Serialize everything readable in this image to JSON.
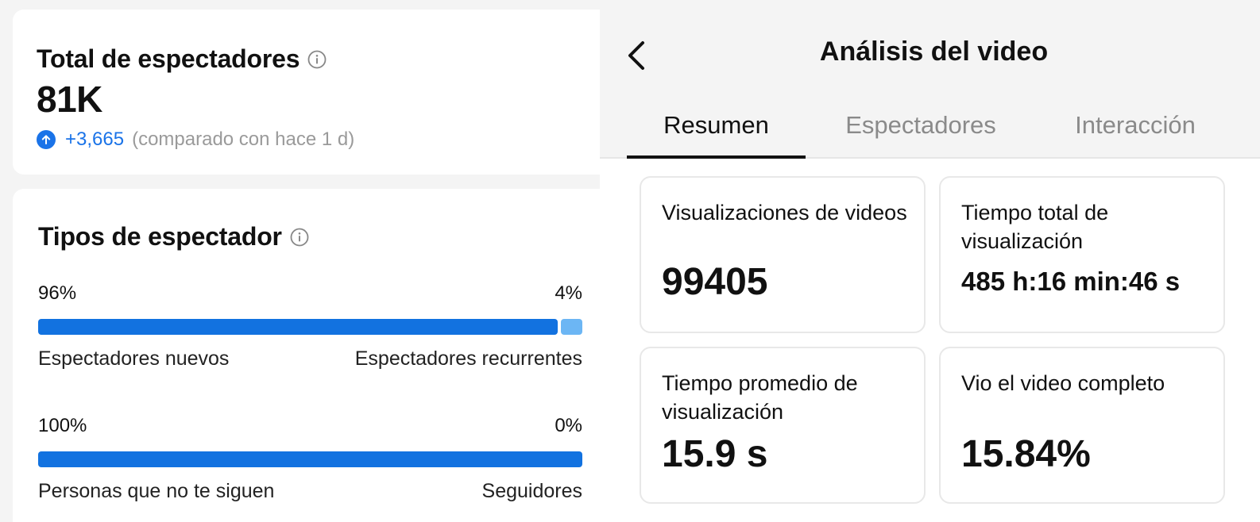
{
  "total_viewers": {
    "title": "Total de espectadores",
    "value": "81K",
    "delta": "+3,665",
    "delta_note": "(comparado con hace 1 d)"
  },
  "viewer_types": {
    "title": "Tipos de espectador",
    "bars": [
      {
        "left_percent": "96%",
        "right_percent": "4%",
        "left_label": "Espectadores nuevos",
        "right_label": "Espectadores recurrentes",
        "fill_fraction": 0.96
      },
      {
        "left_percent": "100%",
        "right_percent": "0%",
        "left_label": "Personas que no te siguen",
        "right_label": "Seguidores",
        "fill_fraction": 1.0
      }
    ]
  },
  "header": {
    "title": "Análisis del video"
  },
  "tabs": [
    {
      "label": "Resumen",
      "active": true
    },
    {
      "label": "Espectadores",
      "active": false
    },
    {
      "label": "Interacción",
      "active": false
    }
  ],
  "metrics": [
    {
      "label": "Visualizaciones de videos",
      "value": "99405"
    },
    {
      "label": "Tiempo total de visualización",
      "value": "485 h:16 min:46 s"
    },
    {
      "label": "Tiempo promedio de visualización",
      "value": "15.9 s"
    },
    {
      "label": "Vio el video completo",
      "value": "15.84%"
    }
  ],
  "colors": {
    "accent": "#1272e0",
    "accent_light": "#6cb6f4",
    "muted": "#9a9a9a"
  },
  "icons": {
    "info": "info-icon",
    "up": "arrow-up-circle-icon",
    "back": "chevron-left-icon"
  }
}
